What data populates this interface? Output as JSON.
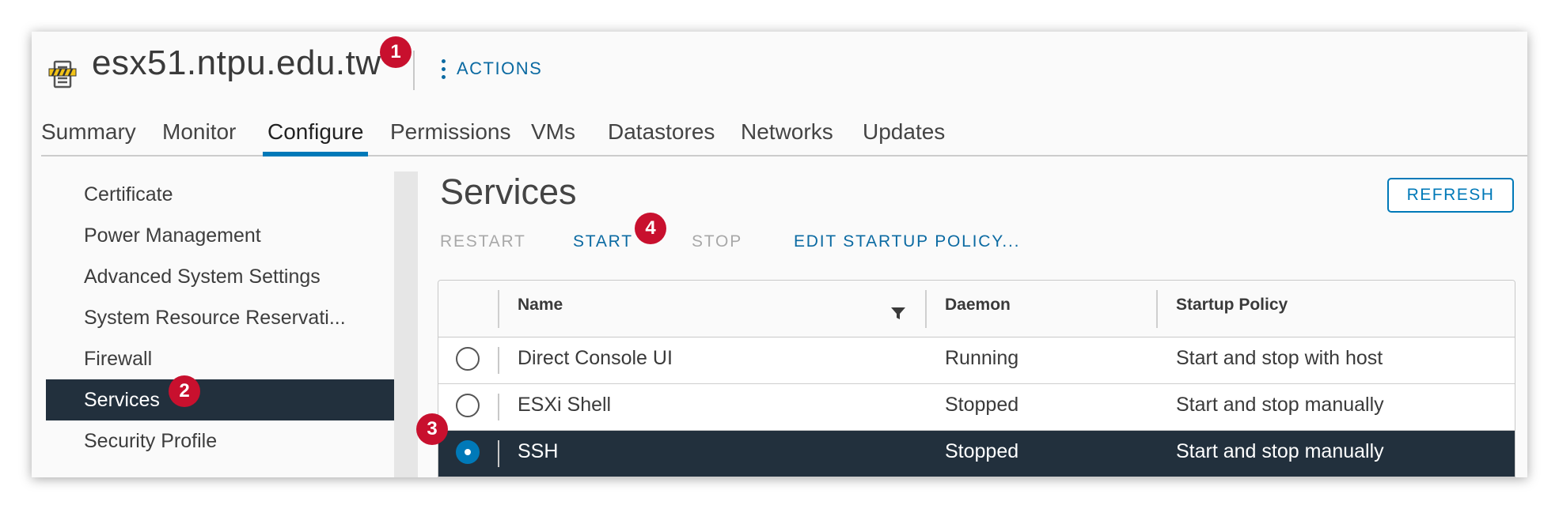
{
  "header": {
    "host_name": "esx51.ntpu.edu.tw",
    "actions_label": "ACTIONS"
  },
  "tabs": [
    {
      "label": "Summary"
    },
    {
      "label": "Monitor"
    },
    {
      "label": "Configure"
    },
    {
      "label": "Permissions"
    },
    {
      "label": "VMs"
    },
    {
      "label": "Datastores"
    },
    {
      "label": "Networks"
    },
    {
      "label": "Updates"
    }
  ],
  "active_tab": "Configure",
  "sidebar": {
    "items": [
      {
        "label": "Certificate"
      },
      {
        "label": "Power Management"
      },
      {
        "label": "Advanced System Settings"
      },
      {
        "label": "System Resource Reservati..."
      },
      {
        "label": "Firewall"
      },
      {
        "label": "Services"
      },
      {
        "label": "Security Profile"
      }
    ],
    "active": "Services"
  },
  "services": {
    "title": "Services",
    "refresh_label": "REFRESH",
    "toolbar": {
      "restart": "RESTART",
      "start": "START",
      "stop": "STOP",
      "edit_policy": "EDIT STARTUP POLICY..."
    },
    "columns": {
      "name": "Name",
      "daemon": "Daemon",
      "policy": "Startup Policy"
    },
    "rows": [
      {
        "name": "Direct Console UI",
        "daemon": "Running",
        "policy": "Start and stop with host",
        "selected": false
      },
      {
        "name": "ESXi Shell",
        "daemon": "Stopped",
        "policy": "Start and stop manually",
        "selected": false
      },
      {
        "name": "SSH",
        "daemon": "Stopped",
        "policy": "Start and stop manually",
        "selected": true
      }
    ]
  },
  "callouts": [
    "1",
    "2",
    "3",
    "4"
  ],
  "colors": {
    "accent": "#0079b8",
    "link": "#0b6aa2",
    "selected_bg": "#22303d",
    "callout": "#c8102e",
    "disabled": "#a8a8a8"
  }
}
